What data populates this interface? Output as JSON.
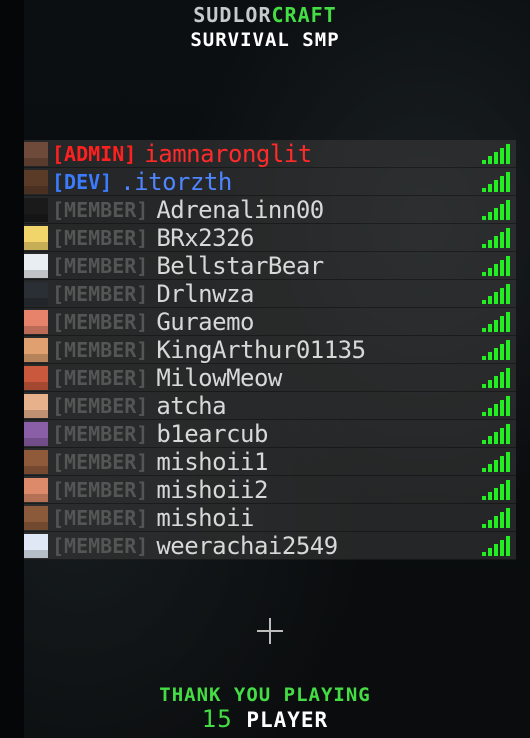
{
  "header": {
    "title_part1": "SUDLOR",
    "title_part2": "CRAFT",
    "subtitle": "SURVIVAL SMP"
  },
  "players": [
    {
      "rank": "[ADMIN]",
      "rank_type": "admin",
      "name": "iamnaronglit",
      "skin": "#6e4a3a"
    },
    {
      "rank": "[DEV]",
      "rank_type": "dev",
      "name": ".itorzth",
      "skin": "#5a3b28"
    },
    {
      "rank": "[MEMBER]",
      "rank_type": "member",
      "name": "Adrenalinn00",
      "skin": "#1a1a1a"
    },
    {
      "rank": "[MEMBER]",
      "rank_type": "member",
      "name": "BRx2326",
      "skin": "#f1d56a"
    },
    {
      "rank": "[MEMBER]",
      "rank_type": "member",
      "name": "BellstarBear",
      "skin": "#e9eef2"
    },
    {
      "rank": "[MEMBER]",
      "rank_type": "member",
      "name": "Drlnwza",
      "skin": "#2a2f35"
    },
    {
      "rank": "[MEMBER]",
      "rank_type": "member",
      "name": "Guraemo",
      "skin": "#e6836a"
    },
    {
      "rank": "[MEMBER]",
      "rank_type": "member",
      "name": "KingArthur01135",
      "skin": "#e0a070"
    },
    {
      "rank": "[MEMBER]",
      "rank_type": "member",
      "name": "MilowMeow",
      "skin": "#c9583d"
    },
    {
      "rank": "[MEMBER]",
      "rank_type": "member",
      "name": "atcha",
      "skin": "#e7b18c"
    },
    {
      "rank": "[MEMBER]",
      "rank_type": "member",
      "name": "b1earcub",
      "skin": "#8a5fa8"
    },
    {
      "rank": "[MEMBER]",
      "rank_type": "member",
      "name": "mishoii1",
      "skin": "#8e5a3a"
    },
    {
      "rank": "[MEMBER]",
      "rank_type": "member",
      "name": "mishoii2",
      "skin": "#dd8a6a"
    },
    {
      "rank": "[MEMBER]",
      "rank_type": "member",
      "name": "mishoii",
      "skin": "#8a5a3a"
    },
    {
      "rank": "[MEMBER]",
      "rank_type": "member",
      "name": "weerachai2549",
      "skin": "#dfe8f4"
    }
  ],
  "ping_icon": "signal-bars-icon",
  "footer": {
    "thanks": "THANK YOU PLAYING",
    "count": "15",
    "count_label": "PLAYER"
  },
  "colors": {
    "admin": "#ff2020",
    "dev": "#3b7cff",
    "member_rank": "#555555",
    "ping": "#22ee22",
    "accent": "#44dd44"
  }
}
